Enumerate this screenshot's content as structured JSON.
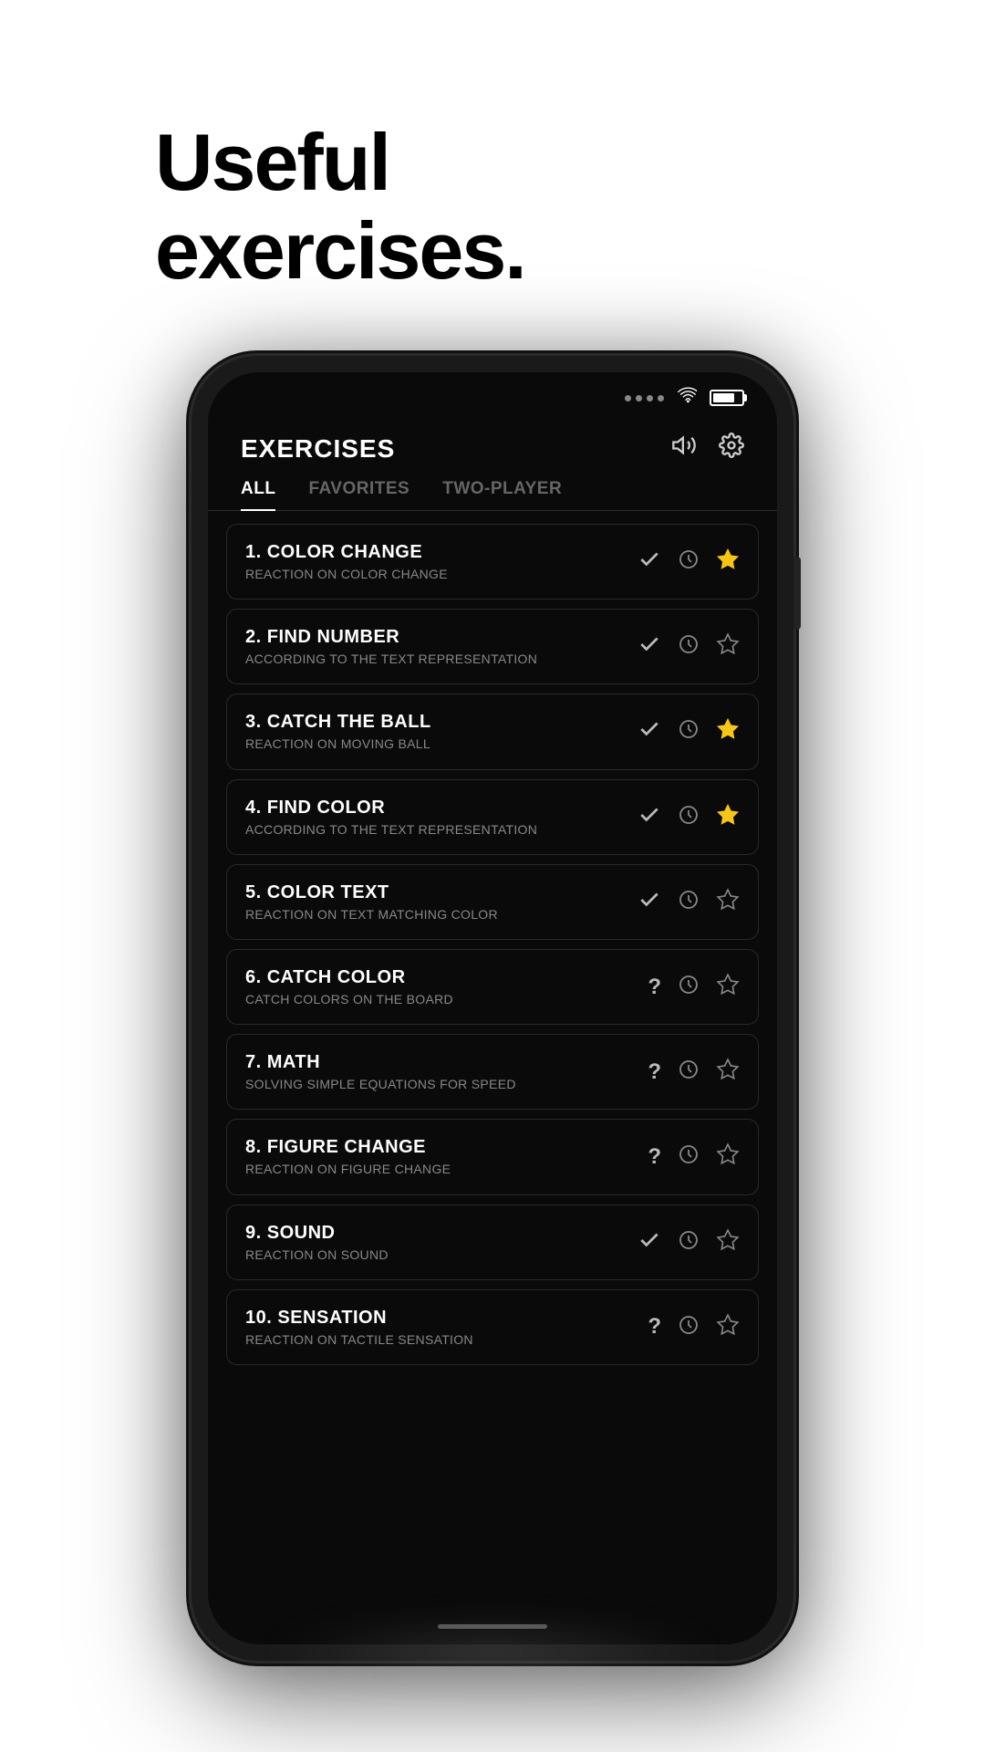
{
  "header": {
    "title": "Useful\nexercises.",
    "line1": "Useful",
    "line2": "exercises."
  },
  "app": {
    "title": "EXERCISES",
    "tabs": [
      {
        "label": "ALL",
        "active": true
      },
      {
        "label": "FAVORITES",
        "active": false
      },
      {
        "label": "TWO-PLAYER",
        "active": false
      }
    ]
  },
  "exercises": [
    {
      "number": "1.",
      "name": "COLOR CHANGE",
      "desc": "REACTION ON COLOR CHANGE",
      "status": "check",
      "favorited": true
    },
    {
      "number": "2.",
      "name": "FIND NUMBER",
      "desc": "ACCORDING TO THE TEXT REPRESENTATION",
      "status": "check",
      "favorited": false
    },
    {
      "number": "3.",
      "name": "CATCH THE BALL",
      "desc": "REACTION ON MOVING BALL",
      "status": "check",
      "favorited": true
    },
    {
      "number": "4.",
      "name": "FIND COLOR",
      "desc": "ACCORDING TO THE TEXT REPRESENTATION",
      "status": "check",
      "favorited": true
    },
    {
      "number": "5.",
      "name": "COLOR TEXT",
      "desc": "REACTION ON TEXT MATCHING COLOR",
      "status": "check",
      "favorited": false
    },
    {
      "number": "6.",
      "name": "CATCH COLOR",
      "desc": "CATCH COLORS ON THE BOARD",
      "status": "question",
      "favorited": false
    },
    {
      "number": "7.",
      "name": "MATH",
      "desc": "SOLVING SIMPLE EQUATIONS FOR SPEED",
      "status": "question",
      "favorited": false
    },
    {
      "number": "8.",
      "name": "FIGURE CHANGE",
      "desc": "REACTION ON FIGURE CHANGE",
      "status": "question",
      "favorited": false
    },
    {
      "number": "9.",
      "name": "SOUND",
      "desc": "REACTION ON SOUND",
      "status": "check",
      "favorited": false
    },
    {
      "number": "10.",
      "name": "SENSATION",
      "desc": "REACTION ON TACTILE SENSATION",
      "status": "question",
      "favorited": false
    }
  ]
}
